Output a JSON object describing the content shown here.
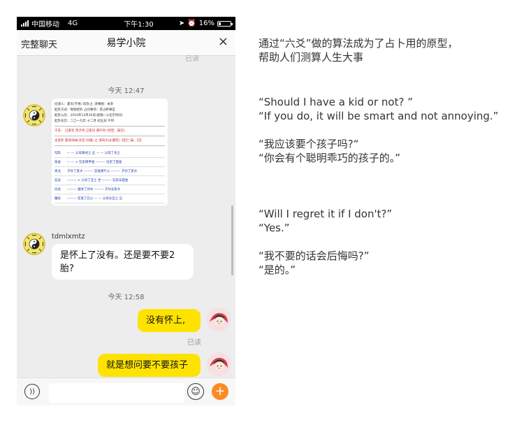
{
  "status": {
    "carrier": "中国移动",
    "network": "4G",
    "time": "下午1:30",
    "icons": [
      "location-icon",
      "alarm-icon"
    ],
    "battery": "16%",
    "battery_level": 0.16
  },
  "navbar": {
    "left": "完整聊天",
    "title": "易学小院",
    "close": "×"
  },
  "chat": {
    "top_read": "已读",
    "time1": "今天 12:47",
    "msg1_user": "tdmlxmtz",
    "msg2_user": "tdmlxmtz",
    "msg2_text_line1": "是怀上了没有。还是要不要2",
    "msg2_text_line2": "胎?",
    "time2": "今天 12:58",
    "msg3_text": "没有怀上,",
    "msg3_read": "已读",
    "msg4_text": "就是想问要不要孩子",
    "msg4_read": "已读"
  },
  "hexagram_doc": {
    "header_lines": [
      "问测人：夏天(学易) 四卦占: 测事图：本卦",
      "起卦方式：铜钱摇卦 占问事项：求占断事宜",
      "起卦公历：2019年12月30日(星期一)(北京时间)",
      "起卦农历：二〇一九年 十二月 初五日 午时"
    ],
    "ganzhi": "干支：   己亥年   丙子月   己亥日   庚午时 (旬空：辰巳)",
    "gua_title": "主变卦   雷泽归妹(兑宫·归魂)  之  泽风大过(震宫)【空亡:辰、巳】",
    "rows": [
      {
        "god": "勾陈",
        "text": "—  —  父母庚戌土 应     —  —  父母丁未土"
      },
      {
        "god": "朱雀",
        "text": "—  — × 兄弟庚申金        ———  兄弟丁酉金"
      },
      {
        "god": "青龙",
        "text": "子孙丁亥水  ———  官鬼庚午火     ———  子孙丁亥水"
      },
      {
        "god": "玄武",
        "text": "———  × 父母丁丑土 世     ———  兄弟辛酉金"
      },
      {
        "god": "白虎",
        "text": "———  妻财丁卯木          ———  子孙辛亥水"
      },
      {
        "god": "螣蛇",
        "text": "——— 官鬼丁巳火          —  —  父母辛丑土 应"
      }
    ]
  },
  "input": {
    "voice_label": "))",
    "emoji_label": "☺",
    "plus_label": "+"
  },
  "caption": {
    "intro_line1": "通过“六爻”做的算法成为了占卜用的原型，",
    "intro_line2": "帮助人们测算人生大事",
    "q1_en_line1": "“Should I have a kid or not? ”",
    "q1_en_line2": "“If you do, it will be smart and not annoying.”",
    "q1_cn_line1": "“我应该要个孩子吗?“",
    "q1_cn_line2": "“你会有个聪明乖巧的孩子的。”",
    "q2_en_line1": "“Will I regret it if I don't?”",
    "q2_en_line2": "“Yes.”",
    "q2_cn_line1": "“我不要的话会后悔吗?”",
    "q2_cn_line2": "“是的。”"
  },
  "colors": {
    "accent_bubble": "#fee300",
    "plus_button": "#fb8b24",
    "chat_background": "#ededed",
    "doc_red": "#c8202a",
    "doc_blue": "#2040b0"
  }
}
